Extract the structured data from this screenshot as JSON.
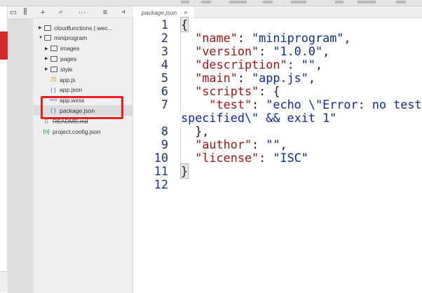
{
  "toolbar_left": {
    "icons": [
      "simulator-icon",
      "split-panel-icon"
    ]
  },
  "explorer_toolbar": {
    "icons": [
      "add-icon",
      "search-icon",
      "more-icon",
      "collapse-icon",
      "panel-toggle-icon"
    ]
  },
  "explorer": {
    "items": [
      {
        "label": "cloudfunctions | wec...",
        "type": "cloud-folder",
        "depth": 0,
        "expanded": false
      },
      {
        "label": "miniprogram",
        "type": "folder",
        "depth": 0,
        "expanded": true
      },
      {
        "label": "images",
        "type": "folder",
        "depth": 1,
        "expanded": false
      },
      {
        "label": "pages",
        "type": "folder",
        "depth": 1,
        "expanded": false
      },
      {
        "label": "style",
        "type": "folder",
        "depth": 1,
        "expanded": false
      },
      {
        "label": "app.js",
        "type": "js",
        "depth": 1,
        "badge": "JS"
      },
      {
        "label": "app.json",
        "type": "json",
        "depth": 1,
        "badge": "{ }"
      },
      {
        "label": "app.wxss",
        "type": "wxss",
        "depth": 1,
        "badge": "wxss"
      },
      {
        "label": "package.json",
        "type": "json",
        "depth": 1,
        "badge": "{ }",
        "selected": true
      },
      {
        "label": "README.md",
        "type": "md",
        "depth": 0,
        "badge": "▯"
      },
      {
        "label": "project.config.json",
        "type": "config",
        "depth": 0,
        "badge": "{o}"
      }
    ]
  },
  "editor": {
    "tab_label": "package.json",
    "tab_close": "×",
    "lines": [
      {
        "n": "1",
        "tokens": [
          [
            "p",
            "{"
          ]
        ]
      },
      {
        "n": "2",
        "tokens": [
          [
            "p",
            "  "
          ],
          [
            "k",
            "\"name\""
          ],
          [
            "p",
            ": "
          ],
          [
            "s",
            "\"miniprogram\""
          ],
          [
            "p",
            ","
          ]
        ]
      },
      {
        "n": "3",
        "tokens": [
          [
            "p",
            "  "
          ],
          [
            "k",
            "\"version\""
          ],
          [
            "p",
            ": "
          ],
          [
            "s",
            "\"1.0.0\""
          ],
          [
            "p",
            ","
          ]
        ]
      },
      {
        "n": "4",
        "tokens": [
          [
            "p",
            "  "
          ],
          [
            "k",
            "\"description\""
          ],
          [
            "p",
            ": "
          ],
          [
            "s",
            "\"\""
          ],
          [
            "p",
            ","
          ]
        ]
      },
      {
        "n": "5",
        "tokens": [
          [
            "p",
            "  "
          ],
          [
            "k",
            "\"main\""
          ],
          [
            "p",
            ": "
          ],
          [
            "s",
            "\"app.js\""
          ],
          [
            "p",
            ","
          ]
        ]
      },
      {
        "n": "6",
        "tokens": [
          [
            "p",
            "  "
          ],
          [
            "k",
            "\"scripts\""
          ],
          [
            "p",
            ": {"
          ]
        ]
      },
      {
        "n": "7",
        "tokens": [
          [
            "p",
            "    "
          ],
          [
            "k",
            "\"test\""
          ],
          [
            "p",
            ": "
          ],
          [
            "s",
            "\"echo \\\"Error: no test"
          ]
        ]
      },
      {
        "n": "",
        "tokens": [
          [
            "s",
            "specified\\\" && exit 1\""
          ]
        ]
      },
      {
        "n": "8",
        "tokens": [
          [
            "p",
            "  },"
          ]
        ]
      },
      {
        "n": "9",
        "tokens": [
          [
            "p",
            "  "
          ],
          [
            "k",
            "\"author\""
          ],
          [
            "p",
            ": "
          ],
          [
            "s",
            "\"\""
          ],
          [
            "p",
            ","
          ]
        ]
      },
      {
        "n": "10",
        "tokens": [
          [
            "p",
            "  "
          ],
          [
            "k",
            "\"license\""
          ],
          [
            "p",
            ": "
          ],
          [
            "s",
            "\"ISC\""
          ]
        ]
      },
      {
        "n": "11",
        "tokens": [
          [
            "p",
            "}"
          ]
        ]
      },
      {
        "n": "12",
        "tokens": []
      }
    ]
  },
  "colors": {
    "key": "#a31515",
    "string": "#0b2c96",
    "line_number": "#1a2f80",
    "highlight_box": "#ee1c1c"
  }
}
